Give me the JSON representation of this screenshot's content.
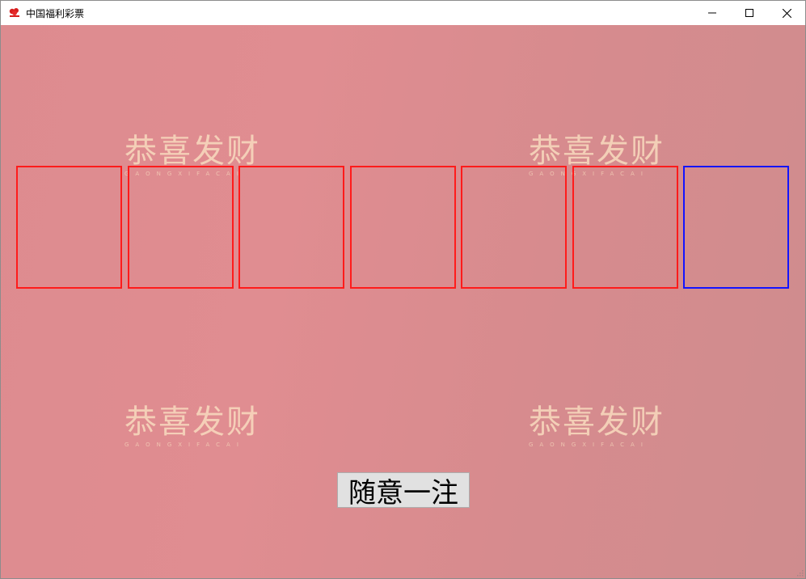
{
  "window": {
    "title": "中国福利彩票",
    "icon": "lottery-logo-icon",
    "controls": [
      "minimize-icon",
      "maximize-icon",
      "close-icon"
    ]
  },
  "watermark": {
    "text": "恭喜发财",
    "subtext": "GAONGXIFACAI",
    "color": "#f8dabe"
  },
  "number_boxes": [
    {
      "color": "#ff1b1b",
      "value": ""
    },
    {
      "color": "#ff1b1b",
      "value": ""
    },
    {
      "color": "#ff1b1b",
      "value": ""
    },
    {
      "color": "#ff1b1b",
      "value": ""
    },
    {
      "color": "#ff1b1b",
      "value": ""
    },
    {
      "color": "#ff1b1b",
      "value": ""
    },
    {
      "color": "#1414ff",
      "value": ""
    }
  ],
  "random_pick_button": {
    "label": "随意一注"
  },
  "colors": {
    "background": "#dd8b8f",
    "red_ball_border": "#ff1b1b",
    "blue_ball_border": "#1414ff"
  }
}
